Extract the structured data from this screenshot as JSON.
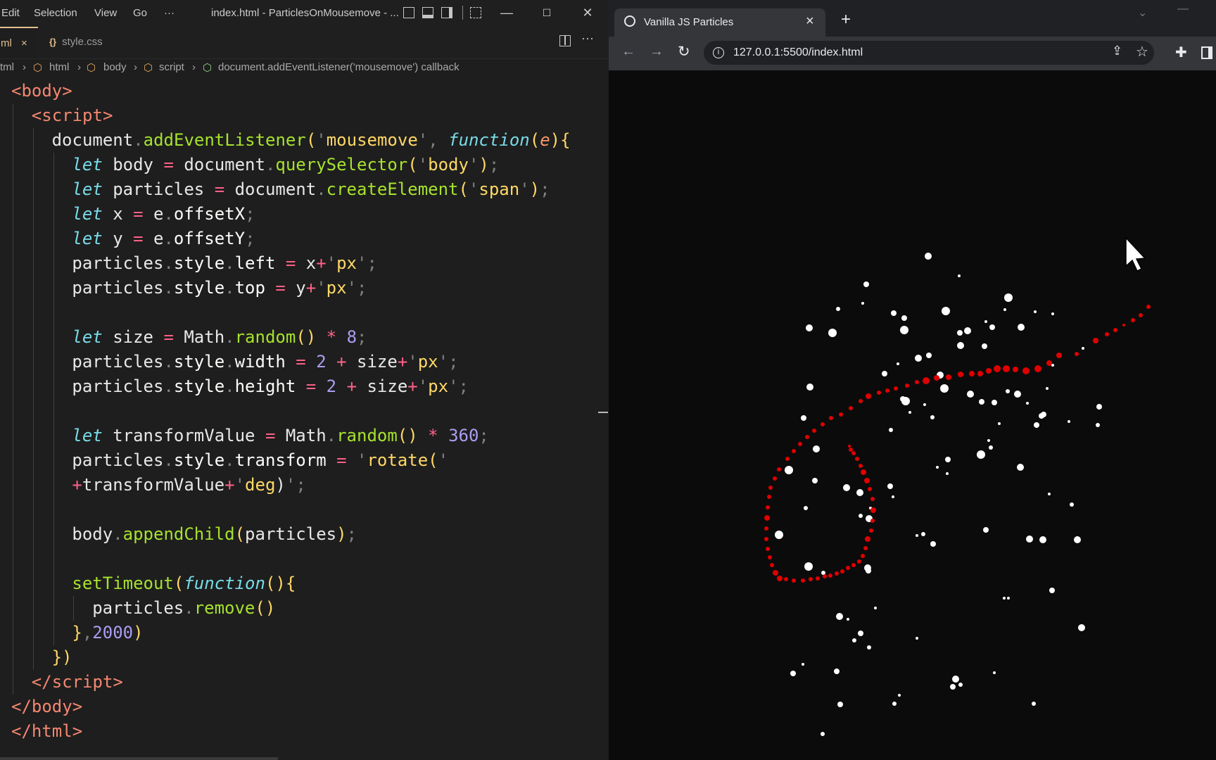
{
  "vscode": {
    "menu": [
      "Edit",
      "Selection",
      "View",
      "Go",
      "···"
    ],
    "window_title": "index.html - ParticlesOnMousemove - ...",
    "tabs": [
      {
        "label": "ml",
        "close": "×",
        "active": true,
        "color": "#e2c08d"
      },
      {
        "icon": "{}",
        "label": "style.css",
        "active": false
      }
    ],
    "breadcrumb": [
      "tml",
      "html",
      "body",
      "script",
      "document.addEventListener('mousemove') callback"
    ],
    "code_lines": [
      {
        "indent": 0,
        "tokens": [
          [
            "tag",
            "<"
          ],
          [
            "tag",
            "body"
          ],
          [
            "tag",
            ">"
          ]
        ]
      },
      {
        "indent": 1,
        "tokens": [
          [
            "tag",
            "<"
          ],
          [
            "tag",
            "script"
          ],
          [
            "tag",
            ">"
          ]
        ]
      },
      {
        "indent": 2,
        "tokens": [
          [
            "plain",
            "document"
          ],
          [
            "punc",
            "."
          ],
          [
            "method",
            "addEventListener"
          ],
          [
            "brk",
            "("
          ],
          [
            "punc",
            "'"
          ],
          [
            "str",
            "mousemove"
          ],
          [
            "punc",
            "'"
          ],
          [
            "punc",
            ", "
          ],
          [
            "kw",
            "function"
          ],
          [
            "brk",
            "("
          ],
          [
            "param",
            "e"
          ],
          [
            "brk",
            "){"
          ]
        ]
      },
      {
        "indent": 3,
        "tokens": [
          [
            "kw",
            "let"
          ],
          [
            "plain",
            " body "
          ],
          [
            "op",
            "="
          ],
          [
            "plain",
            " document"
          ],
          [
            "punc",
            "."
          ],
          [
            "method",
            "querySelector"
          ],
          [
            "brk",
            "("
          ],
          [
            "punc",
            "'"
          ],
          [
            "str",
            "body"
          ],
          [
            "punc",
            "'"
          ],
          [
            "brk",
            ")"
          ],
          [
            "punc",
            ";"
          ]
        ]
      },
      {
        "indent": 3,
        "tokens": [
          [
            "kw",
            "let"
          ],
          [
            "plain",
            " particles "
          ],
          [
            "op",
            "="
          ],
          [
            "plain",
            " document"
          ],
          [
            "punc",
            "."
          ],
          [
            "method",
            "createElement"
          ],
          [
            "brk",
            "("
          ],
          [
            "punc",
            "'"
          ],
          [
            "str",
            "span"
          ],
          [
            "punc",
            "'"
          ],
          [
            "brk",
            ")"
          ],
          [
            "punc",
            ";"
          ]
        ]
      },
      {
        "indent": 3,
        "tokens": [
          [
            "kw",
            "let"
          ],
          [
            "plain",
            " x "
          ],
          [
            "op",
            "="
          ],
          [
            "plain",
            " e"
          ],
          [
            "punc",
            "."
          ],
          [
            "prop",
            "offsetX"
          ],
          [
            "punc",
            ";"
          ]
        ]
      },
      {
        "indent": 3,
        "tokens": [
          [
            "kw",
            "let"
          ],
          [
            "plain",
            " y "
          ],
          [
            "op",
            "="
          ],
          [
            "plain",
            " e"
          ],
          [
            "punc",
            "."
          ],
          [
            "prop",
            "offsetY"
          ],
          [
            "punc",
            ";"
          ]
        ]
      },
      {
        "indent": 3,
        "tokens": [
          [
            "plain",
            "particles"
          ],
          [
            "punc",
            "."
          ],
          [
            "prop",
            "style"
          ],
          [
            "punc",
            "."
          ],
          [
            "prop",
            "left"
          ],
          [
            "plain",
            " "
          ],
          [
            "op",
            "="
          ],
          [
            "plain",
            " x"
          ],
          [
            "op",
            "+"
          ],
          [
            "punc",
            "'"
          ],
          [
            "str",
            "px"
          ],
          [
            "punc",
            "'"
          ],
          [
            "punc",
            ";"
          ]
        ]
      },
      {
        "indent": 3,
        "tokens": [
          [
            "plain",
            "particles"
          ],
          [
            "punc",
            "."
          ],
          [
            "prop",
            "style"
          ],
          [
            "punc",
            "."
          ],
          [
            "prop",
            "top"
          ],
          [
            "plain",
            " "
          ],
          [
            "op",
            "="
          ],
          [
            "plain",
            " y"
          ],
          [
            "op",
            "+"
          ],
          [
            "punc",
            "'"
          ],
          [
            "str",
            "px"
          ],
          [
            "punc",
            "'"
          ],
          [
            "punc",
            ";"
          ]
        ]
      },
      {
        "indent": 3,
        "tokens": []
      },
      {
        "indent": 3,
        "tokens": [
          [
            "kw",
            "let"
          ],
          [
            "plain",
            " size "
          ],
          [
            "op",
            "="
          ],
          [
            "plain",
            " Math"
          ],
          [
            "punc",
            "."
          ],
          [
            "method",
            "random"
          ],
          [
            "brk",
            "()"
          ],
          [
            "plain",
            " "
          ],
          [
            "op",
            "*"
          ],
          [
            "plain",
            " "
          ],
          [
            "num",
            "8"
          ],
          [
            "punc",
            ";"
          ]
        ]
      },
      {
        "indent": 3,
        "tokens": [
          [
            "plain",
            "particles"
          ],
          [
            "punc",
            "."
          ],
          [
            "prop",
            "style"
          ],
          [
            "punc",
            "."
          ],
          [
            "prop",
            "width"
          ],
          [
            "plain",
            " "
          ],
          [
            "op",
            "="
          ],
          [
            "plain",
            " "
          ],
          [
            "num",
            "2"
          ],
          [
            "plain",
            " "
          ],
          [
            "op",
            "+"
          ],
          [
            "plain",
            " size"
          ],
          [
            "op",
            "+"
          ],
          [
            "punc",
            "'"
          ],
          [
            "str",
            "px"
          ],
          [
            "punc",
            "'"
          ],
          [
            "punc",
            ";"
          ]
        ]
      },
      {
        "indent": 3,
        "tokens": [
          [
            "plain",
            "particles"
          ],
          [
            "punc",
            "."
          ],
          [
            "prop",
            "style"
          ],
          [
            "punc",
            "."
          ],
          [
            "prop",
            "height"
          ],
          [
            "plain",
            " "
          ],
          [
            "op",
            "="
          ],
          [
            "plain",
            " "
          ],
          [
            "num",
            "2"
          ],
          [
            "plain",
            " "
          ],
          [
            "op",
            "+"
          ],
          [
            "plain",
            " size"
          ],
          [
            "op",
            "+"
          ],
          [
            "punc",
            "'"
          ],
          [
            "str",
            "px"
          ],
          [
            "punc",
            "'"
          ],
          [
            "punc",
            ";"
          ]
        ]
      },
      {
        "indent": 3,
        "tokens": []
      },
      {
        "indent": 3,
        "tokens": [
          [
            "kw",
            "let"
          ],
          [
            "plain",
            " transformValue "
          ],
          [
            "op",
            "="
          ],
          [
            "plain",
            " Math"
          ],
          [
            "punc",
            "."
          ],
          [
            "method",
            "random"
          ],
          [
            "brk",
            "()"
          ],
          [
            "plain",
            " "
          ],
          [
            "op",
            "*"
          ],
          [
            "plain",
            " "
          ],
          [
            "num",
            "360"
          ],
          [
            "punc",
            ";"
          ]
        ]
      },
      {
        "indent": 3,
        "tokens": [
          [
            "plain",
            "particles"
          ],
          [
            "punc",
            "."
          ],
          [
            "prop",
            "style"
          ],
          [
            "punc",
            "."
          ],
          [
            "prop",
            "transform"
          ],
          [
            "plain",
            " "
          ],
          [
            "op",
            "="
          ],
          [
            "plain",
            " "
          ],
          [
            "punc",
            "'"
          ],
          [
            "str",
            "rotate("
          ],
          [
            "punc",
            "'"
          ]
        ]
      },
      {
        "indent": 3,
        "tokens": [
          [
            "op",
            "+"
          ],
          [
            "plain",
            "transformValue"
          ],
          [
            "op",
            "+"
          ],
          [
            "punc",
            "'"
          ],
          [
            "str",
            "deg"
          ],
          [
            "plain",
            ")"
          ],
          [
            "punc",
            "'"
          ],
          [
            "punc",
            ";"
          ]
        ]
      },
      {
        "indent": 3,
        "tokens": []
      },
      {
        "indent": 3,
        "tokens": [
          [
            "plain",
            "body"
          ],
          [
            "punc",
            "."
          ],
          [
            "method",
            "appendChild"
          ],
          [
            "brk",
            "("
          ],
          [
            "plain",
            "particles"
          ],
          [
            "brk",
            ")"
          ],
          [
            "punc",
            ";"
          ]
        ]
      },
      {
        "indent": 3,
        "tokens": []
      },
      {
        "indent": 3,
        "tokens": [
          [
            "method",
            "setTimeout"
          ],
          [
            "brk",
            "("
          ],
          [
            "kw",
            "function"
          ],
          [
            "brk",
            "(){"
          ]
        ]
      },
      {
        "indent": 4,
        "tokens": [
          [
            "plain",
            "particles"
          ],
          [
            "punc",
            "."
          ],
          [
            "method",
            "remove"
          ],
          [
            "brk",
            "()"
          ]
        ]
      },
      {
        "indent": 3,
        "tokens": [
          [
            "brk",
            "}"
          ],
          [
            "punc",
            ","
          ],
          [
            "num",
            "2000"
          ],
          [
            "brk",
            ")"
          ]
        ]
      },
      {
        "indent": 2,
        "tokens": [
          [
            "brk",
            "})"
          ]
        ]
      },
      {
        "indent": 1,
        "tokens": [
          [
            "tag",
            "</"
          ],
          [
            "tag",
            "script"
          ],
          [
            "tag",
            ">"
          ]
        ]
      },
      {
        "indent": 0,
        "tokens": [
          [
            "tag",
            "</"
          ],
          [
            "tag",
            "body"
          ],
          [
            "tag",
            ">"
          ]
        ]
      },
      {
        "indent": 0,
        "tokens": [
          [
            "tag",
            "</"
          ],
          [
            "tag",
            "html"
          ],
          [
            "tag",
            ">"
          ]
        ]
      }
    ]
  },
  "browser": {
    "tab_title": "Vanilla JS Particles",
    "url": "127.0.0.1:5500/index.html",
    "new_tab": "+",
    "close": "×",
    "colors": {
      "particle_white": "#ffffff",
      "particle_red": "#e00000",
      "background": "#0b0b0b"
    }
  }
}
